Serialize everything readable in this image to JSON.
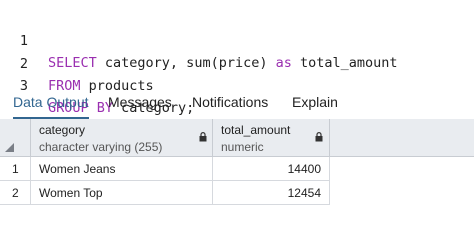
{
  "editor": {
    "lines": [
      {
        "no": "1",
        "kw1": "SELECT",
        "mid": " category, sum(price) ",
        "kw2": "as",
        "rest": " total_amount"
      },
      {
        "no": "2",
        "kw1": "FROM",
        "mid": " products",
        "kw2": "",
        "rest": ""
      },
      {
        "no": "3",
        "kw1": "GROUP BY",
        "mid": " category;",
        "kw2": "",
        "rest": ""
      }
    ]
  },
  "tabs": [
    "Data Output",
    "Messages",
    "Notifications",
    "Explain"
  ],
  "grid": {
    "columns": [
      {
        "name": "category",
        "type": "character varying (255)"
      },
      {
        "name": "total_amount",
        "type": "numeric"
      }
    ],
    "rows": [
      {
        "num": "1",
        "category": "Women Jeans",
        "total_amount": "14400"
      },
      {
        "num": "2",
        "category": "Women Top",
        "total_amount": "12454"
      }
    ]
  },
  "colors": {
    "keyword": "#9a2fb0",
    "active_tab": "#326690",
    "header_bg": "#e9ecf0"
  }
}
